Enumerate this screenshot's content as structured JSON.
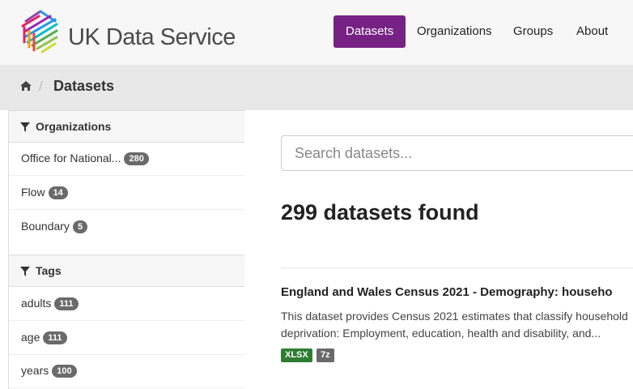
{
  "header": {
    "brand": "UK Data Service",
    "nav": [
      {
        "label": "Datasets",
        "active": true
      },
      {
        "label": "Organizations",
        "active": false
      },
      {
        "label": "Groups",
        "active": false
      },
      {
        "label": "About",
        "active": false
      }
    ],
    "accent_color": "#762284"
  },
  "breadcrumb": {
    "home_icon": "home-icon",
    "current": "Datasets"
  },
  "sidebar": {
    "organizations": {
      "title": "Organizations",
      "icon": "filter-icon",
      "items": [
        {
          "label": "Office for National...",
          "count": "280"
        },
        {
          "label": "Flow",
          "count": "14"
        },
        {
          "label": "Boundary",
          "count": "5"
        }
      ]
    },
    "tags": {
      "title": "Tags",
      "icon": "filter-icon",
      "items": [
        {
          "label": "adults",
          "count": "111"
        },
        {
          "label": "age",
          "count": "111"
        },
        {
          "label": "years",
          "count": "100"
        }
      ]
    }
  },
  "main": {
    "search_placeholder": "Search datasets...",
    "results_count": "299 datasets found",
    "datasets": [
      {
        "title": "England and Wales Census 2021 - Demography: househo",
        "description_line1": "This dataset provides Census 2021 estimates that classify household",
        "description_line2": "deprivation: Employment, education, health and disability, and...",
        "formats": [
          {
            "label": "XLSX",
            "color": "#2e7d32"
          },
          {
            "label": "7z",
            "color": "#6a6a6a"
          }
        ]
      }
    ]
  }
}
